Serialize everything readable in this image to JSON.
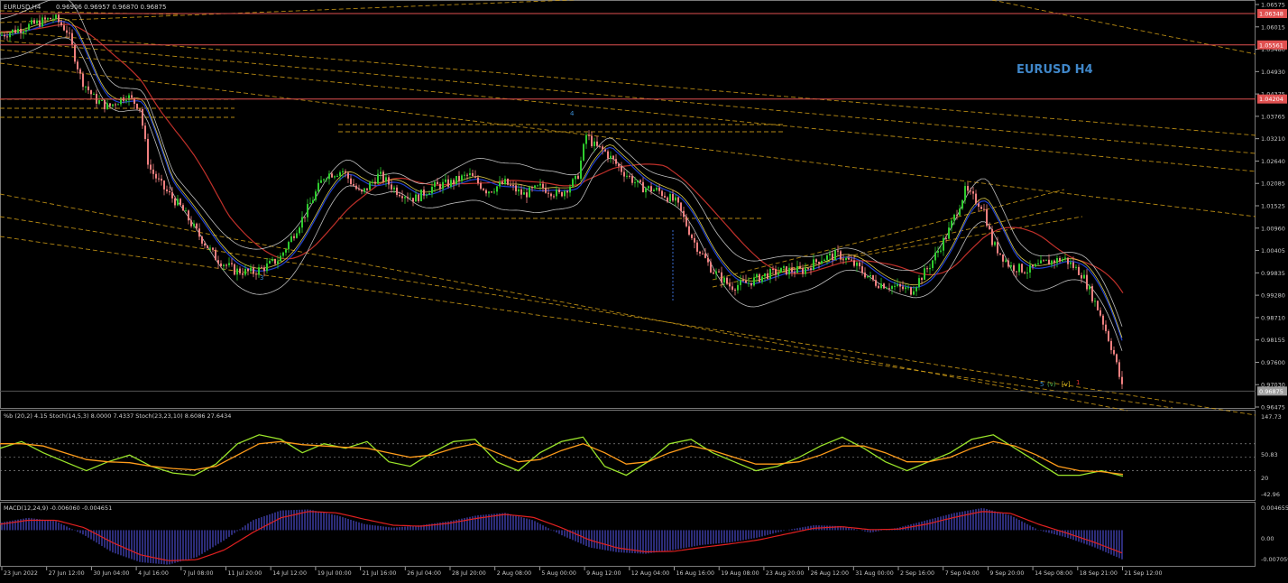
{
  "main_header": {
    "symbol": "EURUSD,H4",
    "ohlc": "0.96906 0.96957 0.96870 0.96875"
  },
  "title_label": "EURUSD H4",
  "price_axis": [
    "1.06575",
    "1.06015",
    "1.05480",
    "1.04930",
    "1.04375",
    "1.03765",
    "1.03210",
    "1.02640",
    "1.02085",
    "1.01525",
    "1.00960",
    "1.00405",
    "0.99835",
    "0.99280",
    "0.98710",
    "0.98155",
    "0.97600",
    "0.97030",
    "0.96475"
  ],
  "price_tags": [
    {
      "value": "1.06348",
      "price": 1.06348,
      "color": "#e05050"
    },
    {
      "value": "1.05561",
      "price": 1.05561,
      "color": "#e05050"
    },
    {
      "value": "1.04204",
      "price": 1.04204,
      "color": "#e05050"
    },
    {
      "value": "0.96875",
      "price": 0.96875,
      "color": "#9e9e9e"
    }
  ],
  "wave_labels": [
    {
      "text": "3",
      "color": "#3a8cd0"
    },
    {
      "text": "4",
      "color": "#3a8cd0"
    },
    {
      "text": "5",
      "color": "#3a8cd0"
    },
    {
      "text": "(v)",
      "color": "#4caf50"
    },
    {
      "text": "[v]",
      "color": "#e0c020"
    },
    {
      "text": "1",
      "color": "#e03030"
    }
  ],
  "stoch_header": "%b (20,2) 4.15  Stoch(14,5,3) 8.0000 7.4337  Stoch(23,23,10) 8.6086 27.6434",
  "stoch_axis": [
    "147.73",
    "50.83",
    "20",
    "-42.96"
  ],
  "macd_header": "MACD(12,24,9) -0.006060 -0.004651",
  "macd_axis": [
    "0.004655",
    "0.00",
    "-0.007059"
  ],
  "time_axis": [
    "23 Jun 2022",
    "27 Jun 12:00",
    "30 Jun 04:00",
    "4 Jul 16:00",
    "7 Jul 08:00",
    "11 Jul 20:00",
    "14 Jul 12:00",
    "19 Jul 00:00",
    "21 Jul 16:00",
    "26 Jul 04:00",
    "28 Jul 20:00",
    "2 Aug 08:00",
    "5 Aug 00:00",
    "9 Aug 12:00",
    "12 Aug 04:00",
    "16 Aug 16:00",
    "19 Aug 08:00",
    "23 Aug 20:00",
    "26 Aug 12:00",
    "31 Aug 00:00",
    "2 Sep 16:00",
    "7 Sep 04:00",
    "9 Sep 20:00",
    "14 Sep 08:00",
    "18 Sep 21:00",
    "21 Sep 12:00"
  ],
  "colors": {
    "bull": "#2ecc2e",
    "bear": "#f08080",
    "sma200": "#c0302a",
    "ema": "#2040d0",
    "bands": "#bdbdbd",
    "channel": "#d4a017",
    "stoch_fast": "#9be52a",
    "stoch_slow": "#ff9c1a",
    "macd_hist": "#4a4ac8",
    "macd_signal": "#e02020"
  },
  "chart_data": [
    {
      "type": "candlestick",
      "title": "EURUSD H4",
      "ylim": [
        0.96475,
        1.06575
      ],
      "close_path": [
        [
          0,
          1.058
        ],
        [
          20,
          1.0595
        ],
        [
          40,
          1.061
        ],
        [
          60,
          1.0625
        ],
        [
          75,
          1.059
        ],
        [
          90,
          1.047
        ],
        [
          105,
          1.042
        ],
        [
          120,
          1.04
        ],
        [
          140,
          1.043
        ],
        [
          155,
          1.04
        ],
        [
          165,
          1.025
        ],
        [
          180,
          1.02
        ],
        [
          200,
          1.015
        ],
        [
          220,
          1.008
        ],
        [
          240,
          1.002
        ],
        [
          260,
          0.999
        ],
        [
          280,
          0.9985
        ],
        [
          295,
          1.0
        ],
        [
          310,
          1.002
        ],
        [
          325,
          1.008
        ],
        [
          340,
          1.014
        ],
        [
          360,
          1.023
        ],
        [
          380,
          1.024
        ],
        [
          400,
          1.018
        ],
        [
          420,
          1.023
        ],
        [
          440,
          1.019
        ],
        [
          460,
          1.017
        ],
        [
          480,
          1.02
        ],
        [
          500,
          1.021
        ],
        [
          520,
          1.023
        ],
        [
          540,
          1.019
        ],
        [
          560,
          1.021
        ],
        [
          580,
          1.018
        ],
        [
          600,
          1.02
        ],
        [
          620,
          1.018
        ],
        [
          640,
          1.022
        ],
        [
          650,
          1.033
        ],
        [
          660,
          1.03
        ],
        [
          670,
          1.029
        ],
        [
          690,
          1.024
        ],
        [
          710,
          1.02
        ],
        [
          730,
          1.019
        ],
        [
          750,
          1.016
        ],
        [
          770,
          1.006
        ],
        [
          790,
          0.999
        ],
        [
          810,
          0.995
        ],
        [
          830,
          0.996
        ],
        [
          850,
          0.998
        ],
        [
          870,
          0.999
        ],
        [
          890,
          0.999
        ],
        [
          910,
          1.002
        ],
        [
          930,
          1.003
        ],
        [
          950,
          1.0
        ],
        [
          970,
          0.996
        ],
        [
          990,
          0.995
        ],
        [
          1010,
          0.994
        ],
        [
          1030,
          1.0
        ],
        [
          1050,
          1.008
        ],
        [
          1070,
          1.019
        ],
        [
          1080,
          1.017
        ],
        [
          1090,
          1.015
        ],
        [
          1100,
          1.006
        ],
        [
          1120,
          1.0
        ],
        [
          1140,
          0.999
        ],
        [
          1160,
          1.001
        ],
        [
          1180,
          1.002
        ],
        [
          1200,
          0.998
        ],
        [
          1220,
          0.988
        ],
        [
          1235,
          0.978
        ],
        [
          1245,
          0.96875
        ]
      ]
    },
    {
      "type": "line",
      "title": "Stochastic",
      "ylim": [
        -42.96,
        147.73
      ],
      "series": [
        {
          "name": "Stoch(14,5,3)",
          "values": [
            70,
            85,
            60,
            40,
            20,
            40,
            55,
            30,
            15,
            10,
            35,
            80,
            100,
            90,
            60,
            80,
            70,
            85,
            40,
            30,
            60,
            85,
            90,
            40,
            20,
            60,
            85,
            95,
            30,
            10,
            40,
            80,
            90,
            60,
            40,
            20,
            30,
            50,
            75,
            95,
            70,
            40,
            20,
            40,
            60,
            90,
            100,
            70,
            40,
            10,
            10,
            20,
            8
          ]
        },
        {
          "name": "Stoch(23,23,10)",
          "values": [
            80,
            80,
            75,
            60,
            45,
            40,
            38,
            30,
            25,
            22,
            30,
            55,
            80,
            85,
            78,
            75,
            72,
            70,
            60,
            50,
            55,
            70,
            80,
            60,
            40,
            45,
            65,
            80,
            60,
            35,
            40,
            60,
            75,
            65,
            50,
            35,
            35,
            40,
            55,
            75,
            75,
            60,
            40,
            40,
            50,
            70,
            85,
            75,
            55,
            30,
            20,
            18,
            12
          ]
        }
      ]
    },
    {
      "type": "bar",
      "title": "MACD(12,24,9)",
      "ylim": [
        -0.007059,
        0.004655
      ],
      "series": [
        {
          "name": "MACD",
          "values": [
            0.0015,
            0.0025,
            0.0018,
            -0.001,
            -0.0045,
            -0.0065,
            -0.007,
            -0.0055,
            -0.002,
            0.002,
            0.004,
            0.0042,
            0.003,
            0.0012,
            0.0005,
            0.001,
            0.0018,
            0.003,
            0.0035,
            0.002,
            -0.001,
            -0.0035,
            -0.0045,
            -0.0048,
            -0.004,
            -0.003,
            -0.0025,
            -0.0015,
            0.0,
            0.001,
            0.0008,
            -0.0005,
            0.0005,
            0.002,
            0.0035,
            0.0045,
            0.003,
            0.0,
            -0.0015,
            -0.0035,
            -0.006
          ]
        },
        {
          "name": "Signal",
          "values": [
            0.0012,
            0.002,
            0.002,
            0.0005,
            -0.0025,
            -0.005,
            -0.0062,
            -0.006,
            -0.004,
            -0.0005,
            0.0025,
            0.0038,
            0.0035,
            0.0022,
            0.001,
            0.0008,
            0.0014,
            0.0024,
            0.0032,
            0.0026,
            0.0005,
            -0.002,
            -0.0036,
            -0.0044,
            -0.0043,
            -0.0035,
            -0.0028,
            -0.002,
            -0.0008,
            0.0004,
            0.0007,
            0.0001,
            0.0002,
            0.0012,
            0.0026,
            0.0038,
            0.0034,
            0.0012,
            -0.0006,
            -0.0025,
            -0.0047
          ]
        }
      ]
    }
  ]
}
